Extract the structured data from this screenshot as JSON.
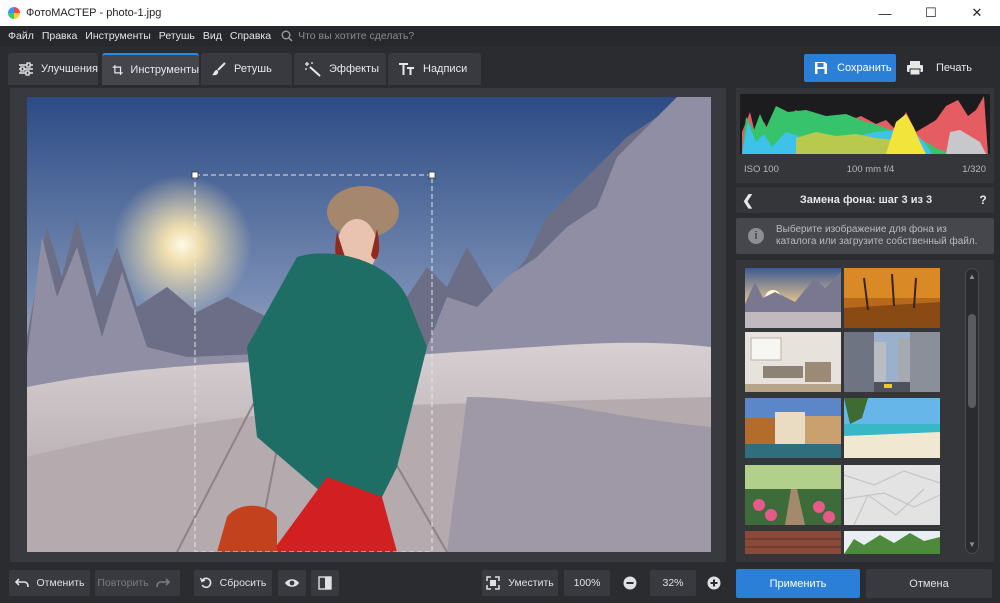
{
  "window": {
    "title": "ФотоМАСТЕР - photo-1.jpg"
  },
  "menu": {
    "items": [
      "Файл",
      "Правка",
      "Инструменты",
      "Ретушь",
      "Вид",
      "Справка"
    ],
    "search_placeholder": "Что вы хотите сделать?"
  },
  "tabs": [
    {
      "label": "Улучшения",
      "icon": "sliders-icon"
    },
    {
      "label": "Инструменты",
      "icon": "crop-icon",
      "active": true
    },
    {
      "label": "Ретушь",
      "icon": "brush-icon"
    },
    {
      "label": "Эффекты",
      "icon": "magic-wand-icon"
    },
    {
      "label": "Надписи",
      "icon": "text-icon"
    }
  ],
  "actions": {
    "save": "Сохранить",
    "print": "Печать"
  },
  "histogram": {
    "iso": "ISO 100",
    "lens": "100 mm f/4",
    "shutter": "1/320"
  },
  "panel": {
    "step_title": "Замена фона: шаг 3 из 3",
    "help": "?",
    "hint_line1": "Выберите изображение для фона из",
    "hint_line2": "каталога или загрузите собственный файл."
  },
  "bottom": {
    "undo": "Отменить",
    "redo": "Повторить",
    "reset": "Сбросить",
    "fit": "Уместить",
    "zoom100": "100%",
    "zoom": "32%",
    "apply": "Применить",
    "cancel": "Отмена"
  },
  "colors": {
    "accent": "#2b7fd6",
    "panel": "#393a3f",
    "bg": "#2b2c30"
  }
}
